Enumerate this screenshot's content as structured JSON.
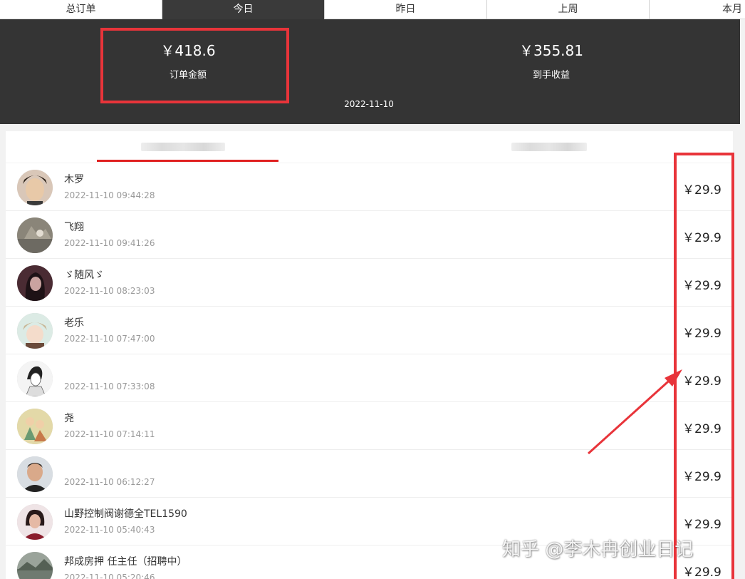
{
  "tabs": [
    {
      "label": "总订单"
    },
    {
      "label": "今日"
    },
    {
      "label": "昨日"
    },
    {
      "label": "上周"
    },
    {
      "label": "本月"
    }
  ],
  "summary": {
    "order_amount": "￥418.6",
    "order_amount_label": "订单金额",
    "net_income": "￥355.81",
    "net_income_label": "到手收益",
    "date": "2022-11-10"
  },
  "orders": [
    {
      "name": "木罗",
      "time": "2022-11-10 09:44:28",
      "price": "￥29.9"
    },
    {
      "name": "飞翔",
      "time": "2022-11-10 09:41:26",
      "price": "￥29.9"
    },
    {
      "name": "ゞ随风ゞ",
      "time": "2022-11-10 08:23:03",
      "price": "￥29.9"
    },
    {
      "name": "老乐",
      "time": "2022-11-10 07:47:00",
      "price": "￥29.9"
    },
    {
      "name": "",
      "time": "2022-11-10 07:33:08",
      "price": "￥29.9"
    },
    {
      "name": "尧",
      "time": "2022-11-10 07:14:11",
      "price": "￥29.9"
    },
    {
      "name": "",
      "time": "2022-11-10 06:12:27",
      "price": "￥29.9"
    },
    {
      "name": "山野控制阀谢德全TEL1590",
      "time": "2022-11-10 05:40:43",
      "price": "￥29.9"
    },
    {
      "name": "邦成房押 任主任（招聘中）",
      "time": "2022-11-10 05:20:46",
      "price": "￥29.9"
    }
  ],
  "watermark": "知乎 @李木冉创业日记",
  "colors": {
    "annotation": "#e8343a",
    "banner": "#343434",
    "active_underline": "#e02020"
  }
}
